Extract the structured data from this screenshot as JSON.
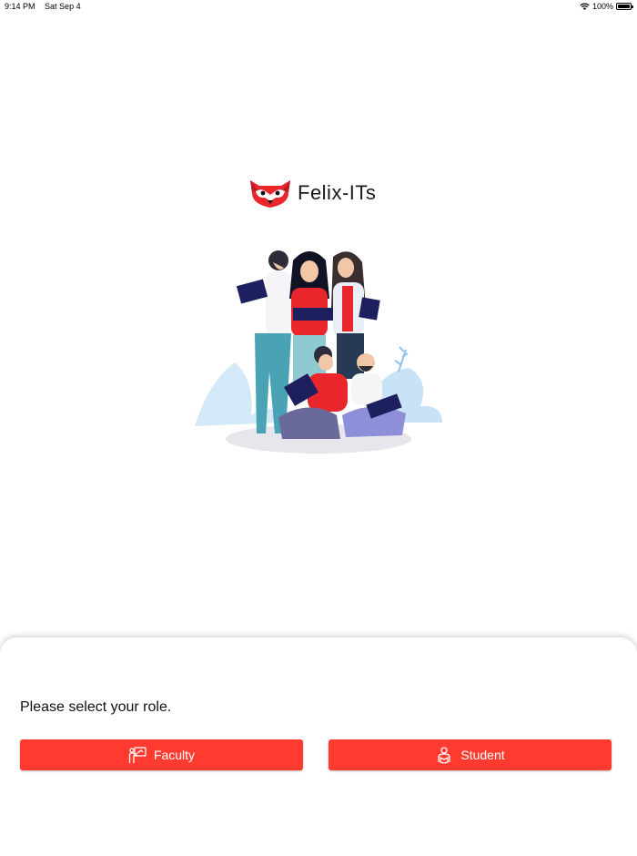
{
  "status": {
    "time": "9:14 PM",
    "date": "Sat Sep 4",
    "battery_label": "100%",
    "battery_level": 1.0
  },
  "brand": {
    "name": "Felix-ITs",
    "logo_icon": "raccoon-logo-icon",
    "accent": "#ff3b30"
  },
  "illustration": {
    "icon": "people-reading-books-illustration"
  },
  "role_sheet": {
    "prompt": "Please select your role.",
    "buttons": [
      {
        "label": "Faculty",
        "icon": "teacher-icon"
      },
      {
        "label": "Student",
        "icon": "student-icon"
      }
    ]
  }
}
